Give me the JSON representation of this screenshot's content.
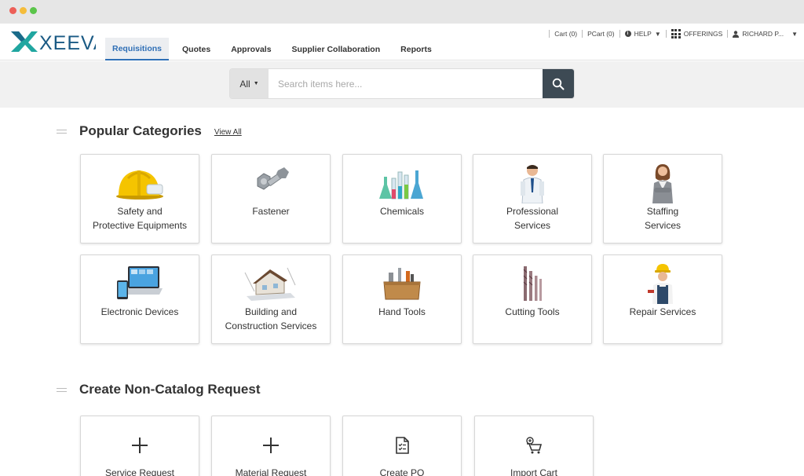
{
  "brand": {
    "logo_text": "XEEVA",
    "accent": "#2f6fb6"
  },
  "nav": {
    "tabs": [
      {
        "label": "Requisitions",
        "active": true
      },
      {
        "label": "Quotes"
      },
      {
        "label": "Approvals"
      },
      {
        "label": "Supplier Collaboration"
      },
      {
        "label": "Reports"
      }
    ]
  },
  "utility": {
    "cart": "Cart (0)",
    "pcart": "PCart (0)",
    "help": "HELP",
    "offerings": "OFFERINGS",
    "user": "RICHARD P..."
  },
  "search": {
    "category": "All",
    "placeholder": "Search items here...",
    "value": ""
  },
  "popular": {
    "title": "Popular Categories",
    "view_all": "View All",
    "items": [
      {
        "label": "Safety and\nProtective Equipments",
        "icon": "hard-hat-icon"
      },
      {
        "label": "Fastener",
        "icon": "bolt-icon"
      },
      {
        "label": "Chemicals",
        "icon": "flasks-icon"
      },
      {
        "label": "Professional\nServices",
        "icon": "businessman-icon"
      },
      {
        "label": "Staffing\nServices",
        "icon": "businesswoman-icon"
      },
      {
        "label": "Electronic Devices",
        "icon": "devices-icon"
      },
      {
        "label": "Building and\nConstruction Services",
        "icon": "house-icon"
      },
      {
        "label": "Hand Tools",
        "icon": "toolbox-icon"
      },
      {
        "label": "Cutting Tools",
        "icon": "drill-bits-icon"
      },
      {
        "label": "Repair Services",
        "icon": "worker-icon"
      }
    ]
  },
  "noncatalog": {
    "title": "Create Non-Catalog Request",
    "items": [
      {
        "label": "Service Request",
        "icon": "plus-icon"
      },
      {
        "label": "Material Request",
        "icon": "plus-icon"
      },
      {
        "label": "Create PO",
        "icon": "document-icon"
      },
      {
        "label": "Import Cart",
        "icon": "cart-icon"
      }
    ]
  }
}
